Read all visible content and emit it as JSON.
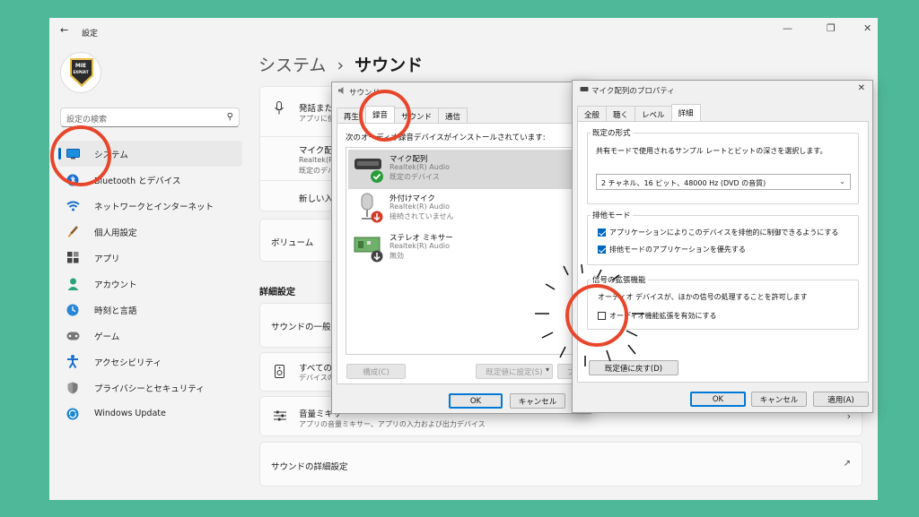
{
  "settings": {
    "back_glyph": "←",
    "title": "設定",
    "controls": [
      "—",
      "❐",
      "✕"
    ],
    "logo_text": [
      "MIE",
      "EXPERT"
    ],
    "search_placeholder": "設定の検索",
    "nav": [
      {
        "label": "システム",
        "icon": "monitor-icon",
        "active": true
      },
      {
        "label": "Bluetooth とデバイス",
        "icon": "bluetooth-icon"
      },
      {
        "label": "ネットワークとインターネット",
        "icon": "wifi-icon"
      },
      {
        "label": "個人用設定",
        "icon": "brush-icon"
      },
      {
        "label": "アプリ",
        "icon": "apps-icon"
      },
      {
        "label": "アカウント",
        "icon": "person-icon"
      },
      {
        "label": "時刻と言語",
        "icon": "globe-clock-icon"
      },
      {
        "label": "ゲーム",
        "icon": "gamepad-icon"
      },
      {
        "label": "アクセシビリティ",
        "icon": "accessibility-icon"
      },
      {
        "label": "プライバシーとセキュリティ",
        "icon": "shield-icon"
      },
      {
        "label": "Windows Update",
        "icon": "update-icon"
      }
    ],
    "breadcrumb_parent": "システム",
    "breadcrumb_sep": "›",
    "breadcrumb_current": "サウンド",
    "input_items": [
      {
        "title": "発話また",
        "sub": "アプリに使"
      },
      {
        "title": "マイク配列",
        "sub": "Realtek(R",
        "sub2": "既定のデバ"
      },
      {
        "title": "新しい入"
      }
    ],
    "volume_label": "ボリューム",
    "section_title": "詳細設定",
    "general_label": "サウンドの一般的",
    "all_devices_title": "すべての",
    "all_devices_sub": "デバイスの",
    "mixer_title": "音量ミキサー",
    "mixer_sub": "アプリの音量ミキサー、アプリの入力および出力デバイス",
    "advanced_label": "サウンドの詳細設定",
    "chevron": "›",
    "external_glyph": "↗"
  },
  "sound_dialog": {
    "title": "サウンド",
    "tabs": [
      "再生",
      "録音",
      "サウンド",
      "通信"
    ],
    "active_tab": 1,
    "instruction": "次のオーディオ録音デバイスがインストールされています:",
    "devices": [
      {
        "name": "マイク配列",
        "driver": "Realtek(R) Audio",
        "status": "既定のデバイス",
        "badge": "✓"
      },
      {
        "name": "外付けマイク",
        "driver": "Realtek(R) Audio",
        "status": "接続されていません",
        "badge": "↓"
      },
      {
        "name": "ステレオ ミキサー",
        "driver": "Realtek(R) Audio",
        "status": "無効",
        "badge": "↓"
      }
    ],
    "configure_btn": "構成(C)",
    "set_default_btn": "既定値に設定(S)",
    "dropdown_glyph": "▾",
    "partial_btn": "プ",
    "ok": "OK",
    "cancel": "キャンセル"
  },
  "props_dialog": {
    "title": "マイク配列のプロパティ",
    "close": "✕",
    "tabs": [
      "全般",
      "聴く",
      "レベル",
      "詳細"
    ],
    "active_tab": 3,
    "format_group": "既定の形式",
    "format_desc": "共有モードで使用されるサンプル レートとビットの深さを選択します。",
    "format_value": "2 チャネル、16 ビット、48000 Hz (DVD の音質)",
    "exclusive_group": "排他モード",
    "exclusive_opt1": "アプリケーションによりこのデバイスを排他的に制御できるようにする",
    "exclusive_opt2": "排他モードのアプリケーションを優先する",
    "enhance_group": "信号の拡張機能",
    "enhance_desc": "オーディオ デバイスが、ほかの信号の処理することを許可します",
    "enhance_opt": "オーディオ機能拡張を有効にする",
    "restore_btn": "既定値に戻す(D)",
    "ok": "OK",
    "cancel": "キャンセル",
    "apply": "適用(A)"
  }
}
